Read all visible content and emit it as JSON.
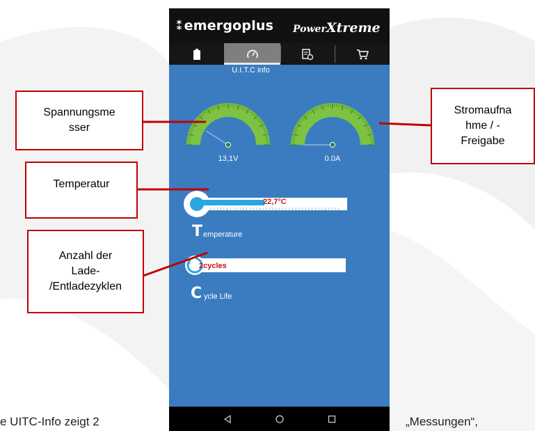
{
  "app": {
    "brand_main": "emergoplus",
    "brand_secondary_small": "Power",
    "brand_secondary_big": "Xtreme",
    "screen_title": "U.I.T.C info"
  },
  "tabs": [
    {
      "icon": "battery-icon",
      "active": false
    },
    {
      "icon": "gauge-icon",
      "active": true
    },
    {
      "icon": "info-document-icon",
      "active": false
    },
    {
      "icon": "cart-icon",
      "active": false
    }
  ],
  "gauges": {
    "voltage": {
      "value": "13,1V",
      "scale_min": 0,
      "scale_max": 60
    },
    "current": {
      "value": "0.0A",
      "scale_min": 0,
      "scale_max": 200
    }
  },
  "temperature": {
    "value": "22,7°C",
    "fill_fraction": 0.45,
    "label_initial": "T",
    "label_rest": "emperature"
  },
  "cycle_life": {
    "value": "2cycles",
    "label_initial": "C",
    "label_rest": "ycle Life"
  },
  "navbar": [
    "back-icon",
    "home-icon",
    "recents-icon"
  ],
  "callouts": {
    "voltage": "Spannungsmesser",
    "current": "Stromaufnahme / -Freigabe",
    "temperature": "Temperatur",
    "cycles": "Anzahl der Lade-/Entladezyklen"
  },
  "callout_lines": {
    "voltage": [
      "Spannungsme",
      "sser"
    ],
    "current": [
      "Stromaufna",
      "hme / -",
      "Freigabe"
    ],
    "temperature": [
      "Temperatur"
    ],
    "cycles": [
      "Anzahl der",
      "Lade-",
      "/Entladezyklen"
    ]
  },
  "page_text": {
    "left": "e UITC-Info zeigt 2",
    "right": "„Messungen“,"
  },
  "colors": {
    "screen_bg": "#3a7cbf",
    "gauge_green": "#7dc242",
    "callout_border": "#c00000",
    "value_red": "#c4161c"
  }
}
